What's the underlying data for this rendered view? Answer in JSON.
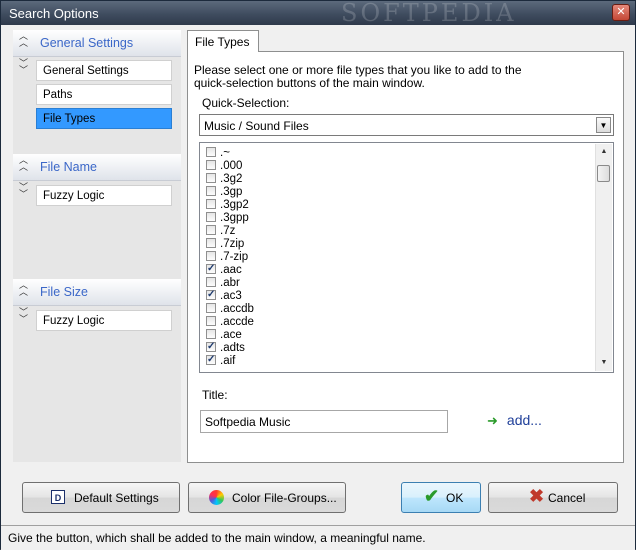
{
  "window": {
    "title": "Search Options",
    "watermark": "SOFTPEDIA"
  },
  "sidebar": {
    "sections": [
      {
        "label": "General Settings",
        "items": [
          "General Settings",
          "Paths",
          "File Types"
        ],
        "selected": "File Types"
      },
      {
        "label": "File Name",
        "items": [
          "Fuzzy Logic"
        ]
      },
      {
        "label": "File Size",
        "items": [
          "Fuzzy Logic"
        ]
      }
    ]
  },
  "tab": {
    "label": "File Types"
  },
  "content": {
    "description_line1": "Please select one or more file types that you like to add to the",
    "description_line2": "quick-selection buttons of the main window.",
    "quick_selection_label": "Quick-Selection:",
    "quick_selection_value": "Music / Sound Files",
    "file_types": [
      {
        "ext": ".~",
        "checked": false
      },
      {
        "ext": ".000",
        "checked": false
      },
      {
        "ext": ".3g2",
        "checked": false
      },
      {
        "ext": ".3gp",
        "checked": false
      },
      {
        "ext": ".3gp2",
        "checked": false
      },
      {
        "ext": ".3gpp",
        "checked": false
      },
      {
        "ext": ".7z",
        "checked": false
      },
      {
        "ext": ".7zip",
        "checked": false
      },
      {
        "ext": ".7-zip",
        "checked": false
      },
      {
        "ext": ".aac",
        "checked": true
      },
      {
        "ext": ".abr",
        "checked": false
      },
      {
        "ext": ".ac3",
        "checked": true
      },
      {
        "ext": ".accdb",
        "checked": false
      },
      {
        "ext": ".accde",
        "checked": false
      },
      {
        "ext": ".ace",
        "checked": false
      },
      {
        "ext": ".adts",
        "checked": true
      },
      {
        "ext": ".aif",
        "checked": true
      }
    ],
    "title_label": "Title:",
    "title_value": "Softpedia Music",
    "add_label": "add..."
  },
  "buttons": {
    "default_settings": "Default Settings",
    "color_file_groups": "Color File-Groups...",
    "ok": "OK",
    "cancel": "Cancel"
  },
  "status": {
    "text": "Give the button, which shall be added to the main window, a meaningful name."
  },
  "colors": {
    "accent": "#3399ff",
    "section_header_text": "#3b67c8",
    "ok_icon": "#2a9a2a",
    "cancel_icon": "#c0392b"
  }
}
